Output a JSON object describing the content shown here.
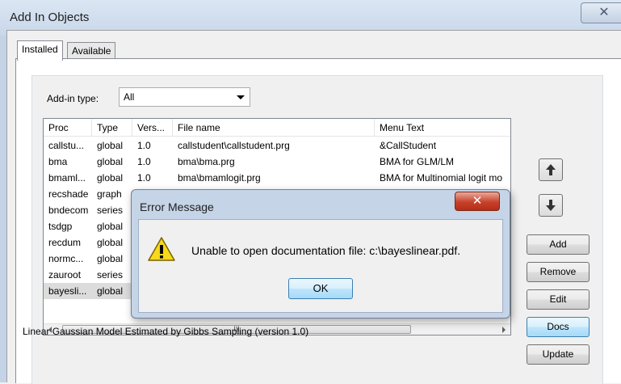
{
  "window": {
    "title": "Add In Objects",
    "close_glyph": "✕"
  },
  "tabs": [
    {
      "label": "Installed",
      "active": true
    },
    {
      "label": "Available",
      "active": false
    }
  ],
  "filter": {
    "label": "Add-in type:",
    "value": "All"
  },
  "table": {
    "columns": [
      "Proc",
      "Type",
      "Vers...",
      "File name",
      "Menu Text"
    ],
    "rows": [
      {
        "proc": "callstu...",
        "type": "global",
        "version": "1.0",
        "file": "callstudent\\callstudent.prg",
        "menu": "&CallStudent"
      },
      {
        "proc": "bma",
        "type": "global",
        "version": "1.0",
        "file": "bma\\bma.prg",
        "menu": "BMA for GLM/LM"
      },
      {
        "proc": "bmaml...",
        "type": "global",
        "version": "1.0",
        "file": "bma\\bmamlogit.prg",
        "menu": "BMA for Multinomial logit mo"
      },
      {
        "proc": "recshade",
        "type": "graph",
        "version": "",
        "file": "",
        "menu": ""
      },
      {
        "proc": "bndecom",
        "type": "series",
        "version": "",
        "file": "",
        "menu": ""
      },
      {
        "proc": "tsdgp",
        "type": "global",
        "version": "",
        "file": "",
        "menu": ""
      },
      {
        "proc": "recdum",
        "type": "global",
        "version": "",
        "file": "",
        "menu": ""
      },
      {
        "proc": "normc...",
        "type": "global",
        "version": "",
        "file": "",
        "menu": ""
      },
      {
        "proc": "zauroot",
        "type": "series",
        "version": "",
        "file": "",
        "menu": ""
      },
      {
        "proc": "bayesli...",
        "type": "global",
        "version": "",
        "file": "",
        "menu": "",
        "selected": true
      }
    ],
    "scroll_grip": "III"
  },
  "buttons": {
    "add": "Add",
    "remove": "Remove",
    "edit": "Edit",
    "docs": "Docs",
    "update": "Update"
  },
  "icons": {
    "up": "arrow-up-icon",
    "down": "arrow-down-icon",
    "warning": "warning-icon"
  },
  "status_text": "Linear Gaussian Model Estimated by Gibbs Sampling (version 1.0)",
  "error_dialog": {
    "title": "Error Message",
    "close_glyph": "✕",
    "message": "Unable to open documentation file:  c:\\bayeslinear.pdf.",
    "ok_label": "OK"
  },
  "colors": {
    "selection": "#dcdcdc",
    "dialog_frame": "#c5d4e7",
    "close_red": "#c7412a"
  }
}
